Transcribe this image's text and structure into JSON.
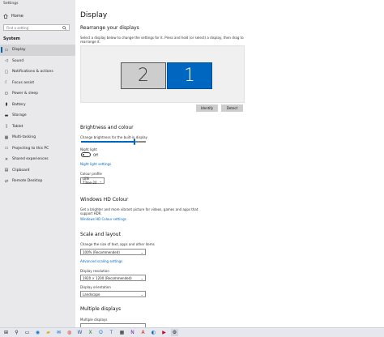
{
  "app": {
    "title": "Settings"
  },
  "sidebar": {
    "home_label": "Home",
    "search_placeholder": "Find a setting",
    "section_label": "System",
    "items": [
      {
        "label": "Display",
        "icon": "monitor-icon",
        "active": true
      },
      {
        "label": "Sound",
        "icon": "speaker-icon"
      },
      {
        "label": "Notifications & actions",
        "icon": "notification-icon"
      },
      {
        "label": "Focus assist",
        "icon": "moon-icon"
      },
      {
        "label": "Power & sleep",
        "icon": "power-icon"
      },
      {
        "label": "Battery",
        "icon": "battery-icon"
      },
      {
        "label": "Storage",
        "icon": "storage-icon"
      },
      {
        "label": "Tablet",
        "icon": "tablet-icon"
      },
      {
        "label": "Multi-tasking",
        "icon": "multitask-icon"
      },
      {
        "label": "Projecting to this PC",
        "icon": "project-icon"
      },
      {
        "label": "Shared experiences",
        "icon": "shared-icon"
      },
      {
        "label": "Clipboard",
        "icon": "clipboard-icon"
      },
      {
        "label": "Remote Desktop",
        "icon": "remote-icon"
      }
    ]
  },
  "main": {
    "title": "Display",
    "rearrange": {
      "heading": "Rearrange your displays",
      "description": "Select a display below to change the settings for it. Press and hold (or select) a display, then drag to rearrange it.",
      "monitor_left": "2",
      "monitor_right": "1",
      "identify_label": "Identify",
      "detect_label": "Detect"
    },
    "brightness": {
      "heading": "Brightness and colour",
      "slider_label": "Change brightness for the built-in display",
      "slider_value": 0.82,
      "night_light_label": "Night light",
      "night_light_state": "Off",
      "night_light_link": "Night light settings",
      "colour_profile_label": "Colour profile",
      "colour_profile_value": "LEN T3lee-20"
    },
    "hd": {
      "heading": "Windows HD Colour",
      "description": "Get a brighter and more vibrant picture for videos, games and apps that support HDR.",
      "link": "Windows HD Colour settings"
    },
    "scale": {
      "heading": "Scale and layout",
      "size_label": "Change the size of text, apps and other items",
      "size_value": "100% (Recommended)",
      "advanced_link": "Advanced scaling settings",
      "resolution_label": "Display resolution",
      "resolution_value": "1920 × 1200 (Recommended)",
      "orientation_label": "Display orientation",
      "orientation_value": "Landscape"
    },
    "multiple": {
      "heading": "Multiple displays",
      "label": "Multiple displays"
    }
  },
  "colors": {
    "accent": "#0067c0",
    "sidebar_bg": "#e9e9eb"
  },
  "taskbar": {
    "icons": [
      "windows-icon",
      "search-icon",
      "taskview-icon",
      "edge-icon",
      "explorer-icon",
      "mail-icon",
      "chrome-icon",
      "word-icon",
      "excel-icon",
      "outlook-icon",
      "teams-icon",
      "store-icon",
      "onenote-icon",
      "acrobat-icon",
      "photos-icon",
      "media-icon",
      "gear-icon"
    ]
  }
}
